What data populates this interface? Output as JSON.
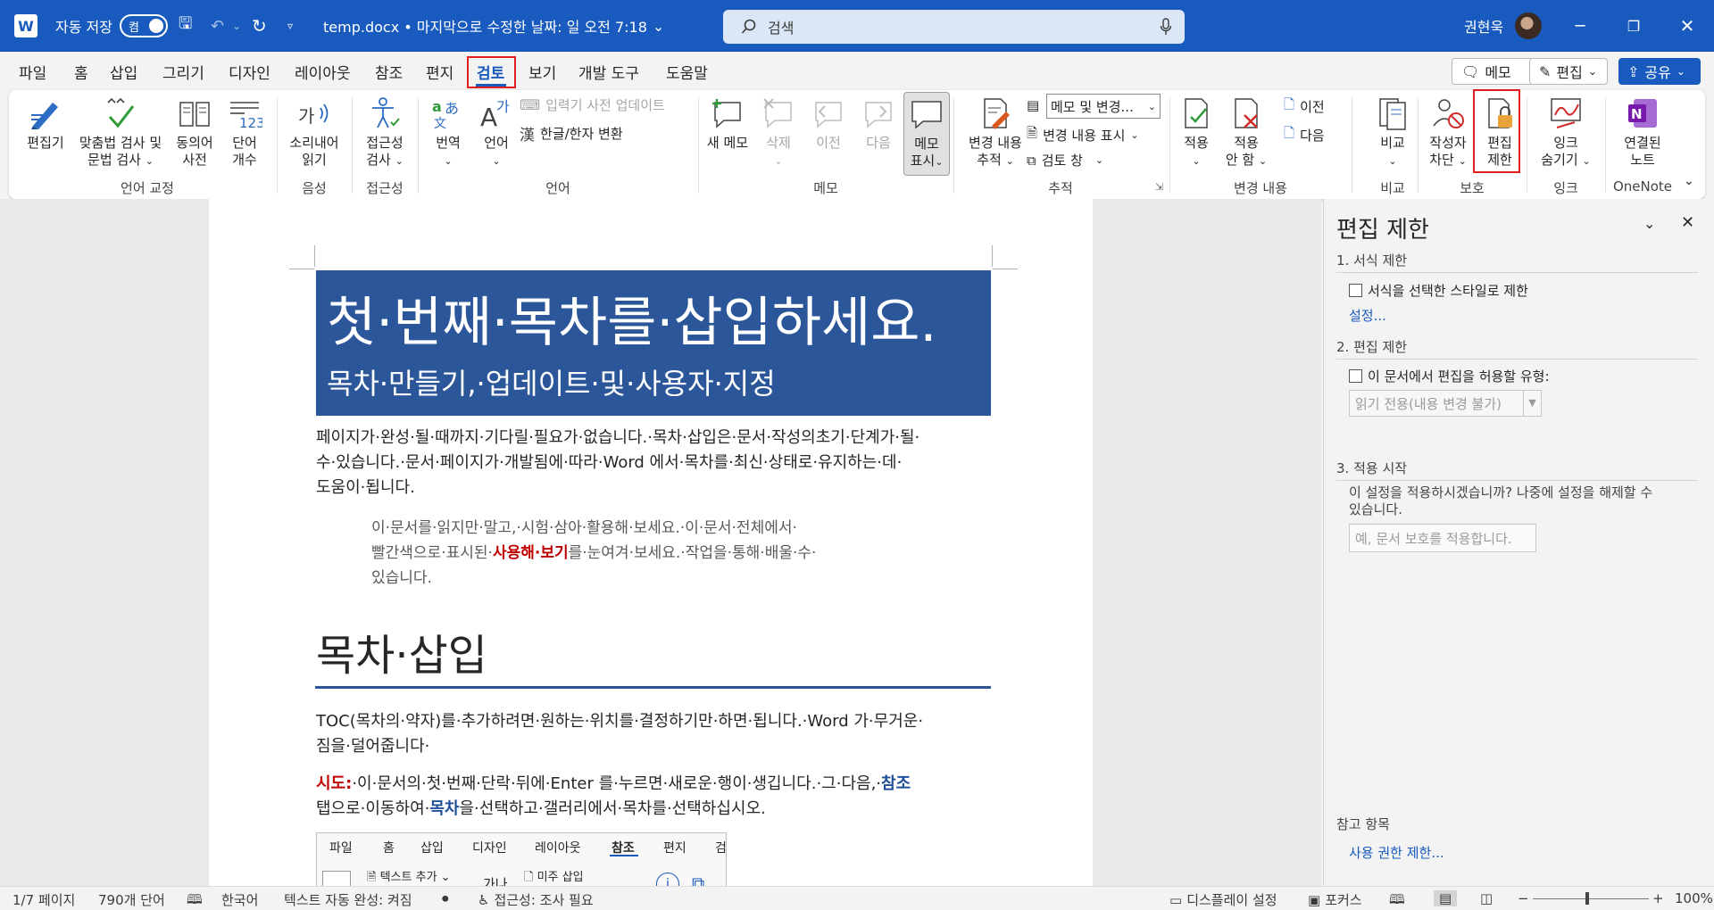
{
  "titlebar": {
    "autosave_label": "자동 저장",
    "autosave_state": "켬",
    "doc_title": "temp.docx • 마지막으로 수정한 날짜: 일 오전 7:18",
    "search_placeholder": "검색",
    "user_name": "권현욱",
    "accent": "#185abd"
  },
  "menu": {
    "tabs": [
      "파일",
      "홈",
      "삽입",
      "그리기",
      "디자인",
      "레이아웃",
      "참조",
      "편지",
      "검토",
      "보기",
      "개발 도구",
      "도움말"
    ],
    "active_tab": "검토",
    "memo_button": "메모",
    "edit_button": "편집",
    "share_button": "공유"
  },
  "ribbon": {
    "proofing": {
      "editor": "편집기",
      "spelling_1": "맞춤법 검사 및",
      "spelling_2": "문법 검사",
      "thesaurus_1": "동의어",
      "thesaurus_2": "사전",
      "wordcount_1": "단어",
      "wordcount_2": "개수",
      "group": "언어 교정"
    },
    "speech": {
      "read_1": "소리내어",
      "read_2": "읽기",
      "group": "음성"
    },
    "accessibility": {
      "check_1": "접근성",
      "check_2": "검사",
      "group": "접근성"
    },
    "language": {
      "translate": "번역",
      "language": "언어",
      "ime_update": "입력기 사전 업데이트",
      "hanja": "한글/한자 변환",
      "group": "언어"
    },
    "comments": {
      "new": "새 메모",
      "delete": "삭제",
      "prev": "이전",
      "next": "다음",
      "show_1": "메모",
      "show_2": "표시",
      "group": "메모"
    },
    "tracking": {
      "track_1": "변경 내용",
      "track_2": "추적",
      "markup_select": "메모 및 변경...",
      "show_markup": "변경 내용 표시",
      "review_pane": "검토 창",
      "group": "추적"
    },
    "changes": {
      "accept": "적용",
      "reject_1": "적용",
      "reject_2": "안 함",
      "prev": "이전",
      "next": "다음",
      "group": "변경 내용"
    },
    "compare": {
      "compare": "비교",
      "group": "비교"
    },
    "protect": {
      "block_1": "작성자",
      "block_2": "차단",
      "restrict_1": "편집",
      "restrict_2": "제한",
      "group": "보호"
    },
    "ink": {
      "hide_1": "잉크",
      "hide_2": "숨기기",
      "group": "잉크"
    },
    "onenote": {
      "linked_1": "연결된",
      "linked_2": "노트",
      "group": "OneNote"
    }
  },
  "document": {
    "title": "첫·번째·목차를·삽입하세요.",
    "subtitle": "목차·만들기,·업데이트·및·사용자·지정",
    "para1_l1": "페이지가·완성·될·때까지·기다릴·필요가·없습니다.·목차·삽입은·문서·작성의초기·단계가·될·",
    "para1_l2": "수·있습니다.·문서·페이지가·개발됨에·따라·Word 에서·목차를·최신·상태로·유지하는·데·",
    "para1_l3": "도움이·됩니다.",
    "quote_l1": "이·문서를·읽지만·말고,·시험·삼아·활용해·보세요.·이·문서·전체에서·",
    "quote_l2_a": "빨간색으로·표시된·",
    "quote_l2_red1": "사용해",
    "quote_l2_dot": "·",
    "quote_l2_red2": "보기",
    "quote_l2_b": "를·눈여겨·보세요.·작업을·통해·배울·수·",
    "quote_l3": "있습니다.",
    "heading": "목차·삽입",
    "para2_l1": "TOC(목차의·약자)를·추가하려면·원하는·위치를·결정하기만·하면·됩니다.·Word 가·무거운·",
    "para2_l2": "짐을·덜어줍니다·",
    "para3_red": "시도:",
    "para3_a": "·이·문서의·첫·번째·단락·뒤에·Enter 를·누르면·새로운·행이·생깁니다.·그·다음,·",
    "para3_blue1": "참조",
    "para3_l2_a": "탭으로·이동하여·",
    "para3_blue2": "목차",
    "para3_l2_b": "을·선택하고·갤러리에서·목차를·선택하십시오.",
    "mini_tabs": [
      "파일",
      "홈",
      "삽입",
      "디자인",
      "레이아웃",
      "참조",
      "편지",
      "검"
    ],
    "mini_active": "참조",
    "mini_text_add": "텍스트 추가",
    "mini_footnote": "미주 삽입",
    "mini_ga": "가나"
  },
  "pane": {
    "title": "편집 제한",
    "sec1": "1. 서식 제한",
    "sec1_check": "서식을 선택한 스타일로 제한",
    "sec1_link": "설정...",
    "sec2": "2. 편집 제한",
    "sec2_check": "이 문서에서 편집을 허용할 유형:",
    "sec2_select": "읽기 전용(내용 변경 불가)",
    "sec3": "3. 적용 시작",
    "sec3_text_1": "이 설정을 적용하시겠습니까? 나중에 설정을 해제할 수",
    "sec3_text_2": "있습니다.",
    "sec3_button": "예, 문서 보호를 적용합니다.",
    "ref_head": "참고 항목",
    "ref_link": "사용 권한 제한..."
  },
  "status": {
    "page": "1/7 페이지",
    "words": "790개 단어",
    "lang": "한국어",
    "autocomplete": "텍스트 자동 완성: 켜짐",
    "accessibility": "접근성: 조사 필요",
    "display": "디스플레이 설정",
    "focus": "포커스",
    "zoom": "100%",
    "zoom_minus": "−",
    "zoom_plus": "+"
  }
}
